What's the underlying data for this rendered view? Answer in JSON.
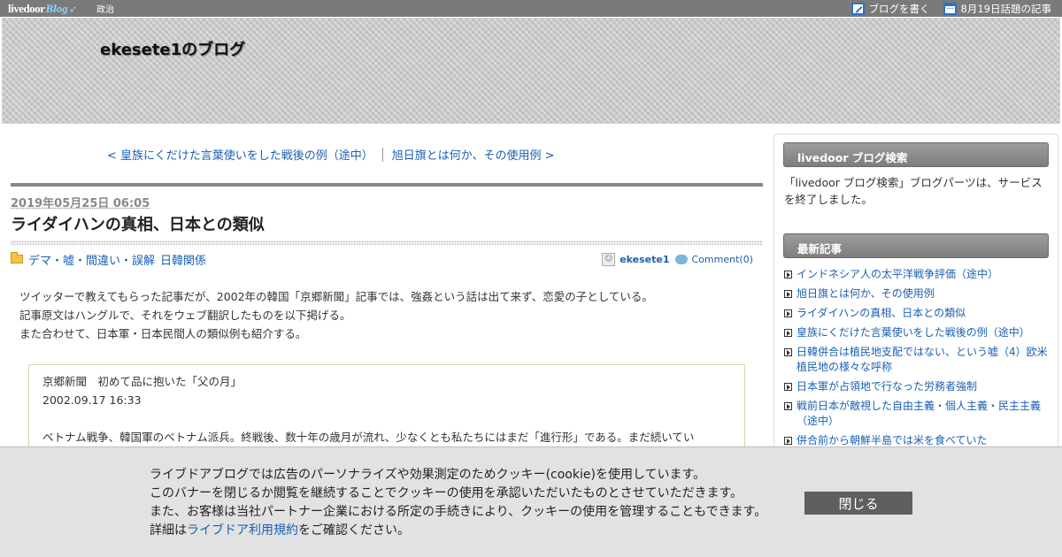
{
  "topbar": {
    "logo_main": "livedoor",
    "logo_sub": "Blog",
    "category": "政治",
    "write_blog": "ブログを書く",
    "topic_articles": "8月19日話題の記事"
  },
  "header": {
    "blog_title": "ekesete1のブログ"
  },
  "pager": {
    "prev": "< 皇族にくだけた言葉使いをした戦後の例（途中）",
    "next": "旭日旗とは何か、その使用例 >"
  },
  "article": {
    "date": "2019年05月25日 06:05",
    "title": "ライダイハンの真相、日本との類似",
    "categories": [
      "デマ・嘘・間違い・誤解",
      "日韓関係"
    ],
    "author": "ekesete1",
    "comment": "Comment(0)",
    "avatar_glyph": "☺",
    "body_lines": [
      "ツイッターで教えてもらった記事だが、2002年の韓国「京郷新聞」記事では、強姦という話は出て来ず、恋愛の子としている。",
      "記事原文はハングルで、それをウェブ翻訳したものを以下掲げる。",
      "また合わせて、日本軍・日本民間人の類似例も紹介する。"
    ],
    "quote_lines": [
      "京郷新聞　初めて品に抱いた「父の月」",
      "2002.09.17 16:33",
      "ベトナム戦争、韓国軍のベトナム派兵。終戦後、数十年の歳月が流れ、少なくとも私たちにはまだ「進行形」である。まだ続いてい"
    ]
  },
  "sidebar": {
    "search_heading": "livedoor ブログ検索",
    "search_text": "「livedoor ブログ検索」ブログパーツは、サービスを終了しました。",
    "recent_heading": "最新記事",
    "recent": [
      "インドネシア人の太平洋戦争評価（途中）",
      "旭日旗とは何か、その使用例",
      "ライダイハンの真相、日本との類似",
      "皇族にくだけた言葉使いをした戦後の例（途中）",
      "日韓併合は植民地支配ではない、という嘘（4）欧米植民地の様々な呼称",
      "日本軍が占領地で行なった労務者強制",
      "戦前日本が敵視した自由主義・個人主義・民主主義（途中）",
      "併合前から朝鮮半島では米を食べていた"
    ]
  },
  "cookie": {
    "line1": "ライブドアブログでは広告のパーソナライズや効果測定のためクッキー(cookie)を使用しています。",
    "line2": "このバナーを閉じるか閲覧を継続することでクッキーの使用を承認いただいたものとさせていただきます。",
    "line3": "また、お客様は当社パートナー企業における所定の手続きにより、クッキーの使用を管理することもできます。",
    "line4_prefix": "詳細は",
    "line4_link": "ライブドア利用規約",
    "line4_suffix": "をご確認ください。",
    "close": "閉じる"
  }
}
